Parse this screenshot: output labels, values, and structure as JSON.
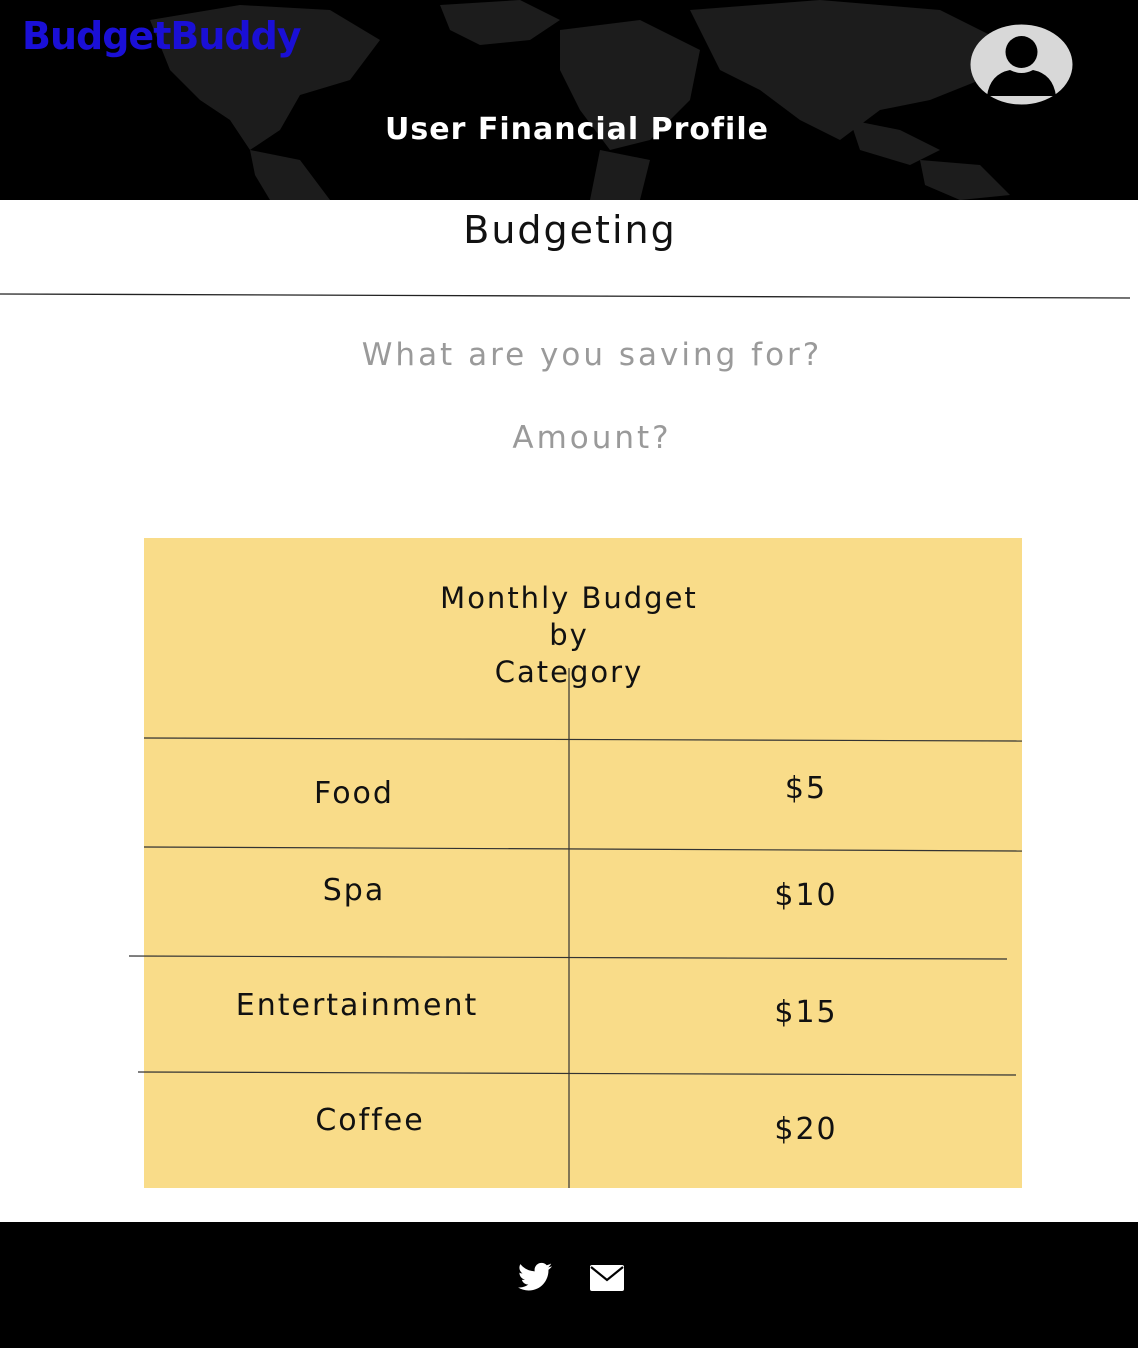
{
  "header": {
    "logo": "BudgetBuddy",
    "title": "User Financial Profile",
    "avatar_icon": "user-avatar-icon"
  },
  "main": {
    "section_title": "Budgeting",
    "saving_goal": {
      "placeholder": "What are you saving for?",
      "value": ""
    },
    "amount": {
      "placeholder": "Amount?",
      "value": ""
    }
  },
  "budget_table": {
    "title": "Monthly Budget by Category",
    "title_line1": "Monthly Budget by",
    "title_line2": "Category",
    "rows": [
      {
        "category": "Food",
        "amount": "$5"
      },
      {
        "category": "Spa",
        "amount": "$10"
      },
      {
        "category": "Entertainment",
        "amount": "$15"
      },
      {
        "category": "Coffee",
        "amount": "$20"
      }
    ]
  },
  "footer": {
    "icons": [
      "twitter-icon",
      "mail-icon"
    ]
  },
  "colors": {
    "header_bg": "#000000",
    "logo": "#1a0fd6",
    "panel_bg": "#f9dc89",
    "placeholder": "#9a9a9a"
  }
}
